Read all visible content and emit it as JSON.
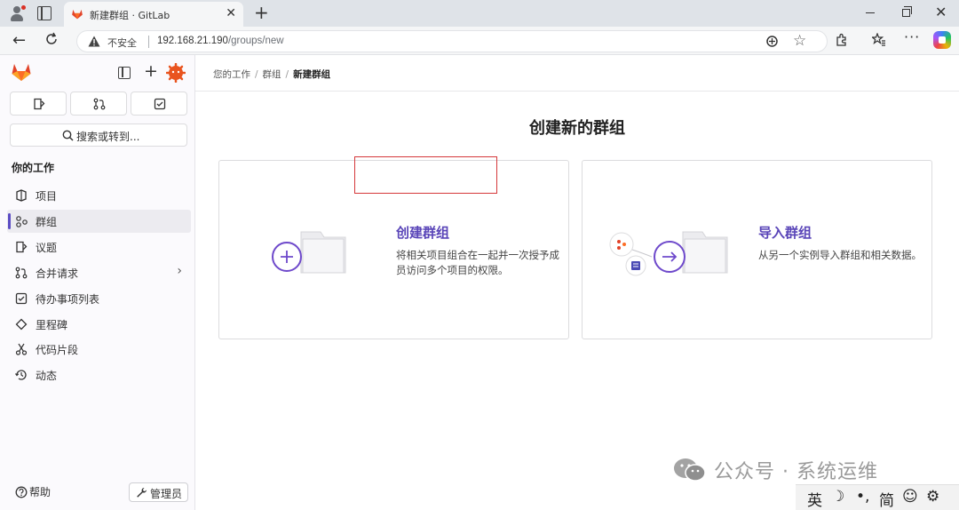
{
  "browser": {
    "tab_title": "新建群组 · GitLab",
    "tab_close": "✕",
    "new_tab": "+",
    "security_label": "不安全",
    "url_host": "192.168.21.190",
    "url_path": "/groups/new",
    "more_label": "···",
    "close_label": "✕"
  },
  "sidebar": {
    "section_title": "你的工作",
    "search_label": "搜索或转到...",
    "items": [
      {
        "label": "项目",
        "icon": "project-icon"
      },
      {
        "label": "群组",
        "icon": "group-icon",
        "active": true
      },
      {
        "label": "议题",
        "icon": "issues-icon"
      },
      {
        "label": "合并请求",
        "icon": "merge-request-icon",
        "has_chevron": true
      },
      {
        "label": "待办事项列表",
        "icon": "todo-icon"
      },
      {
        "label": "里程碑",
        "icon": "milestone-icon"
      },
      {
        "label": "代码片段",
        "icon": "snippet-icon"
      },
      {
        "label": "动态",
        "icon": "activity-icon"
      }
    ],
    "chevron": "›",
    "help_label": "帮助",
    "admin_label": "管理员"
  },
  "breadcrumb": {
    "items": [
      "您的工作",
      "群组",
      "新建群组"
    ],
    "separator": "/"
  },
  "main": {
    "page_title": "创建新的群组",
    "cards": [
      {
        "title": "创建群组",
        "desc": "将相关项目组合在一起并一次授予成员访问多个项目的权限。"
      },
      {
        "title": "导入群组",
        "desc": "从另一个实例导入群组和相关数据。"
      }
    ]
  },
  "overlay": {
    "watermark": "公众号 · 系统运维",
    "ime": [
      "英",
      "☽",
      "•,",
      "简",
      "☺",
      "⚙"
    ]
  },
  "colors": {
    "accent": "#5944b8",
    "highlight": "#d5383a",
    "gitlab_orange": "#e24329"
  }
}
